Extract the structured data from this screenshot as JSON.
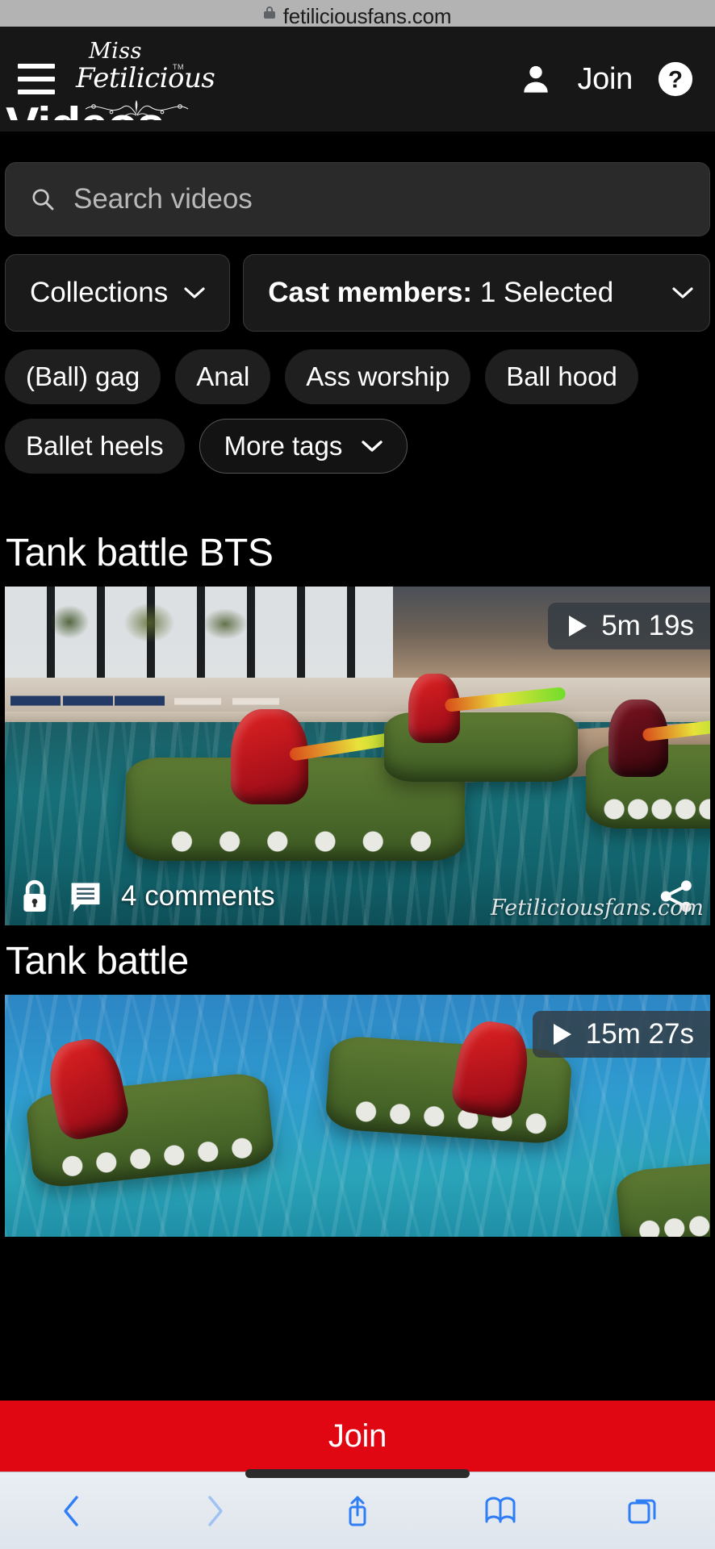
{
  "browser": {
    "url": "fetiliciousfans.com",
    "lock_icon": "lock-icon",
    "bottom_toolbar": [
      {
        "name": "back",
        "icon": "chevron-left-icon"
      },
      {
        "name": "forward",
        "icon": "chevron-right-icon"
      },
      {
        "name": "share",
        "icon": "share-up-icon"
      },
      {
        "name": "bookmarks",
        "icon": "book-icon"
      },
      {
        "name": "tabs",
        "icon": "tabs-icon"
      }
    ]
  },
  "header": {
    "menu_icon": "hamburger-menu-icon",
    "brand": {
      "line1": "Miss",
      "line2": "Fetilicious",
      "tm": "TM"
    },
    "account_icon": "user-icon",
    "join_label": "Join",
    "help_icon": "question-mark-icon"
  },
  "page": {
    "title": "Videos"
  },
  "search": {
    "icon": "search-icon",
    "placeholder": "Search videos",
    "value": ""
  },
  "filters": {
    "collections": {
      "label": "Collections",
      "chevron": "chevron-down-icon"
    },
    "cast_members": {
      "label": "Cast members:",
      "value": " 1 Selected",
      "chevron": "chevron-down-icon"
    }
  },
  "tags": [
    {
      "label": "(Ball) gag",
      "style": "filled"
    },
    {
      "label": "Anal",
      "style": "filled"
    },
    {
      "label": "Ass worship",
      "style": "filled"
    },
    {
      "label": "Ball hood",
      "style": "filled"
    },
    {
      "label": "Ballet heels",
      "style": "filled"
    }
  ],
  "more_tags": {
    "label": "More tags",
    "chevron": "chevron-down-icon"
  },
  "videos": [
    {
      "title": "Tank battle BTS",
      "duration": "5m 19s",
      "play_icon": "play-icon",
      "lock_icon": "lock-icon",
      "comment_icon": "comment-icon",
      "comments": "4 comments",
      "share_icon": "share-icon",
      "watermark": "Fetiliciousfans.com"
    },
    {
      "title": "Tank battle",
      "duration": "15m 27s",
      "play_icon": "play-icon"
    }
  ],
  "join_bar": {
    "label": "Join"
  },
  "colors": {
    "accent_red": "#e10712",
    "header_bg": "#171717",
    "page_bg": "#000000",
    "chrome_bg": "#b3b3b3"
  }
}
